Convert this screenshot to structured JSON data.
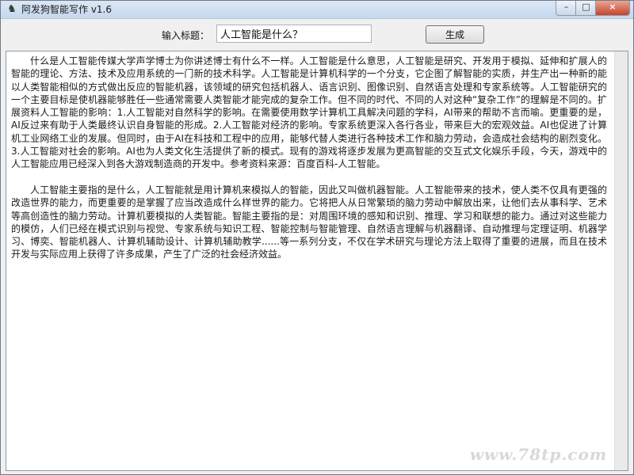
{
  "window": {
    "title": "阿发狗智能写作 v1.6",
    "controls": {
      "minimize": "–",
      "maximize": "□",
      "close": "×"
    }
  },
  "toolbar": {
    "title_label": "输入标题：",
    "title_value": "人工智能是什么？",
    "generate_label": "生成"
  },
  "content": {
    "paragraph_1": "什么是人工智能传媒大学声学博士为你讲述博士有什么不一样。人工智能是什么意思，人工智能是研究、开发用于模拟、延伸和扩展人的智能的理论、方法、技术及应用系统的一门新的技术科学。人工智能是计算机科学的一个分支，它企图了解智能的实质，并生产出一种新的能以人类智能相似的方式做出反应的智能机器，该领域的研究包括机器人、语言识别、图像识别、自然语言处理和专家系统等。人工智能研究的一个主要目标是使机器能够胜任一些通常需要人类智能才能完成的复杂工作。但不同的时代、不同的人对这种“复杂工作”的理解是不同的。扩展资料人工智能的影响：1.人工智能对自然科学的影响。在需要使用数学计算机工具解决问题的学科，AI带来的帮助不言而喻。更重要的是，AI反过来有助于人类最终认识自身智能的形成。2.人工智能对经济的影响。专家系统更深入各行各业，带来巨大的宏观效益。AI也促进了计算机工业网络工业的发展。但同时，由于AI在科技和工程中的应用，能够代替人类进行各种技术工作和脑力劳动，会造成社会结构的剧烈变化。3.人工智能对社会的影响。AI也为人类文化生活提供了新的模式。现有的游戏将逐步发展为更高智能的交互式文化娱乐手段，今天，游戏中的人工智能应用已经深入到各大游戏制造商的开发中。参考资料来源：百度百科-人工智能。",
    "paragraph_2": "人工智能主要指的是什么，人工智能就是用计算机来模拟人的智能，因此又叫做机器智能。人工智能带来的技术，使人类不仅具有更强的改造世界的能力，而更重要的是掌握了应当改造成什么样世界的能力。它将把人从日常繁琐的脑力劳动中解放出来，让他们去从事科学、艺术等高创造性的脑力劳动。计算机要模拟的人类智能。智能主要指的是：对周围环境的感知和识别、推理、学习和联想的能力。通过对这些能力的模仿，人们已经在模式识别与视觉、专家系统与知识工程、智能控制与智能管理、自然语言理解与机器翻译、自动推理与定理证明、机器学习、博奕、智能机器人、计算机辅助设计、计算机辅助教学......等一系列分支，不仅在学术研究与理论方法上取得了重要的进展，而且在技术开发与实际应用上获得了许多成果，产生了广泛的社会经济效益。"
  },
  "watermark": "www.78tp.com"
}
